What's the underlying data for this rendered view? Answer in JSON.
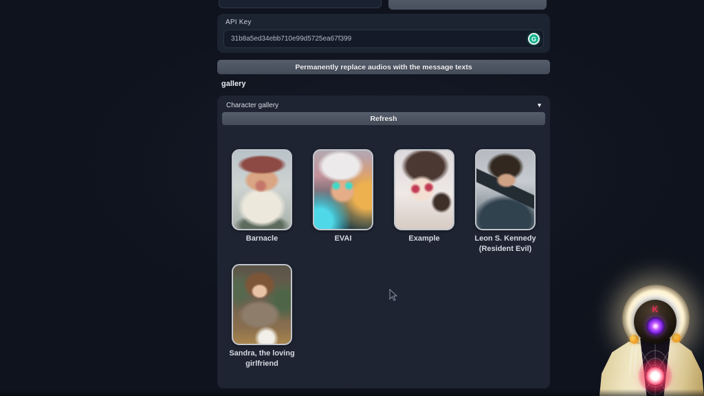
{
  "form": {
    "api_key": {
      "label": "API Key",
      "value": "31b8a5ed34ebb710e99d5725ea67f399"
    },
    "replace_button_label": "Permanently replace audios with the message texts"
  },
  "gallery": {
    "section_label": "gallery",
    "panel_title": "Character gallery",
    "collapse_icon": "▼",
    "refresh_label": "Refresh",
    "cards": [
      {
        "name": "Barnacle"
      },
      {
        "name": "EVAI"
      },
      {
        "name": "Example"
      },
      {
        "name": "Leon S. Kennedy (Resident Evil)"
      },
      {
        "name": "Sandra, the loving girlfriend"
      }
    ]
  },
  "icons": {
    "grammarly": "G"
  },
  "overlay": {
    "avatar_letter": "K"
  },
  "colors": {
    "page_bg": "#0f131d",
    "panel_bg": "#1e2432",
    "input_bg": "#141a27",
    "button_slate": "#4d5563",
    "grammarly_green": "#12b28c",
    "text_light": "#e8ebf0",
    "orb_pink": "#ff3660",
    "eye_violet": "#7a22dd",
    "hoodie_yellow": "#efe6c2"
  }
}
